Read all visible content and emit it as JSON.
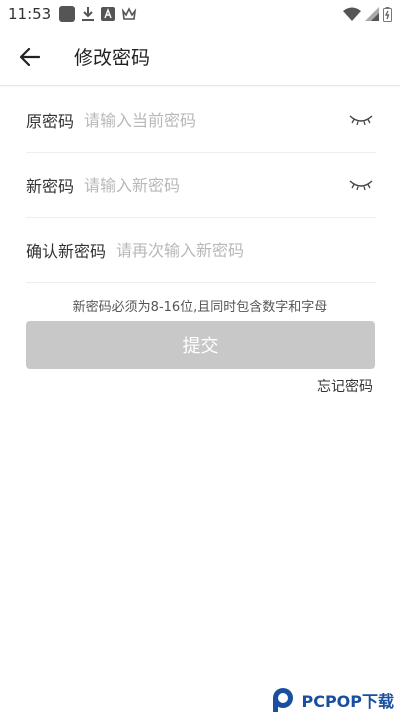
{
  "status_bar": {
    "time": "11:53",
    "left_icons": [
      "app-square-icon",
      "download-icon",
      "a-box-icon",
      "crown-icon"
    ],
    "right_icons": [
      "wifi-icon",
      "signal-icon",
      "battery-icon"
    ]
  },
  "header": {
    "back_icon": "arrow-left-icon",
    "title": "修改密码"
  },
  "form": {
    "old_password": {
      "label": "原密码",
      "placeholder": "请输入当前密码",
      "icon": "eye-closed-icon"
    },
    "new_password": {
      "label": "新密码",
      "placeholder": "请输入新密码",
      "icon": "eye-closed-icon"
    },
    "confirm_password": {
      "label": "确认新密码",
      "placeholder": "请再次输入新密码"
    }
  },
  "hint": "新密码必须为8-16位,且同时包含数字和字母",
  "submit_label": "提交",
  "forgot_label": "忘记密码",
  "watermark": {
    "text": "PCPOP下载"
  },
  "colors": {
    "submit_disabled": "#c8c8c8",
    "placeholder": "#b8b8b8",
    "watermark": "#1a4fa0"
  }
}
